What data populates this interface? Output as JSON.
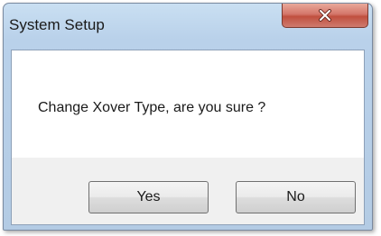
{
  "dialog": {
    "title": "System Setup",
    "message": "Change Xover Type, are you sure ?",
    "close_icon": "close-icon"
  },
  "buttons": {
    "yes_label": "Yes",
    "no_label": "No"
  },
  "colors": {
    "titlebar": "#b9d1ea",
    "close_button": "#c0503f",
    "message_background": "#ffffff",
    "button_area": "#f0f0f0"
  }
}
